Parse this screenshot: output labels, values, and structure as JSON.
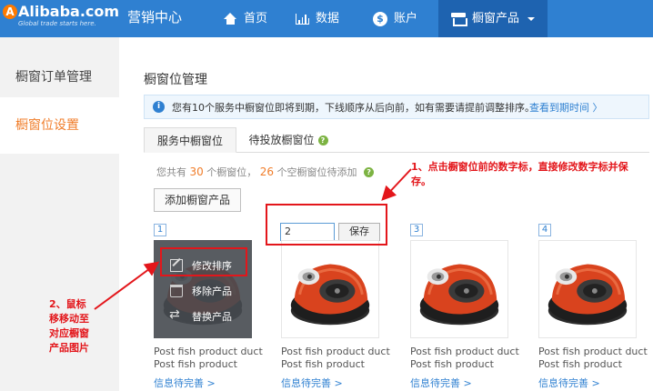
{
  "header": {
    "logo_text": "Alibaba.com",
    "logo_tagline": "Global trade starts here.",
    "brand": "营销中心",
    "nav": {
      "home": "首页",
      "data": "数据",
      "account": "账户",
      "showcase": "橱窗产品"
    }
  },
  "sidebar": {
    "items": [
      {
        "label": "橱窗订单管理"
      },
      {
        "label": "橱窗位设置"
      }
    ]
  },
  "main": {
    "title": "橱窗位管理",
    "notice": {
      "text": "您有10个服务中橱窗位即将到期，下线顺序从后向前，如有需要请提前调整排序。",
      "link": "查看到期时间 〉"
    },
    "tabs": [
      {
        "label": "服务中橱窗位"
      },
      {
        "label": "待投放橱窗位"
      }
    ],
    "count": {
      "prefix": "您共有",
      "total": "30",
      "mid": "个橱窗位，",
      "empty": "26",
      "suffix": "个空橱窗位待添加"
    },
    "add_button": "添加橱窗产品",
    "hover_actions": {
      "edit": "修改排序",
      "remove": "移除产品",
      "replace": "替换产品"
    },
    "edit": {
      "value": "2",
      "save": "保存"
    },
    "slots": [
      {
        "num": "1",
        "name1": "Post fish product duct",
        "name2": "Post fish product",
        "link": "信息待完善 >"
      },
      {
        "num": "2",
        "name1": "Post fish product duct",
        "name2": "Post fish product",
        "link": "信息待完善 >"
      },
      {
        "num": "3",
        "name1": "Post fish product duct",
        "name2": "Post fish product",
        "link": "信息待完善 >"
      },
      {
        "num": "4",
        "name1": "Post fish product duct",
        "name2": "Post fish product",
        "link": "信息待完善 >"
      }
    ]
  },
  "annotations": {
    "note1": "1、点击橱窗位前的数字标，直接修改数字标并保存。",
    "note2": "2、鼠标移移动至对应橱窗产品图片"
  },
  "colors": {
    "header_blue": "#2f80d1",
    "active_nav": "#1e63b0",
    "accent_orange": "#f07d2a",
    "annotation_red": "#e3161b",
    "link_blue": "#2f80d1"
  },
  "icons": {
    "home": "home-icon",
    "data": "bar-chart-icon",
    "account": "coin-icon",
    "showcase": "store-icon",
    "info": "info-icon",
    "help": "question-icon",
    "edit": "edit-icon",
    "remove": "trash-icon",
    "replace": "swap-icon"
  }
}
